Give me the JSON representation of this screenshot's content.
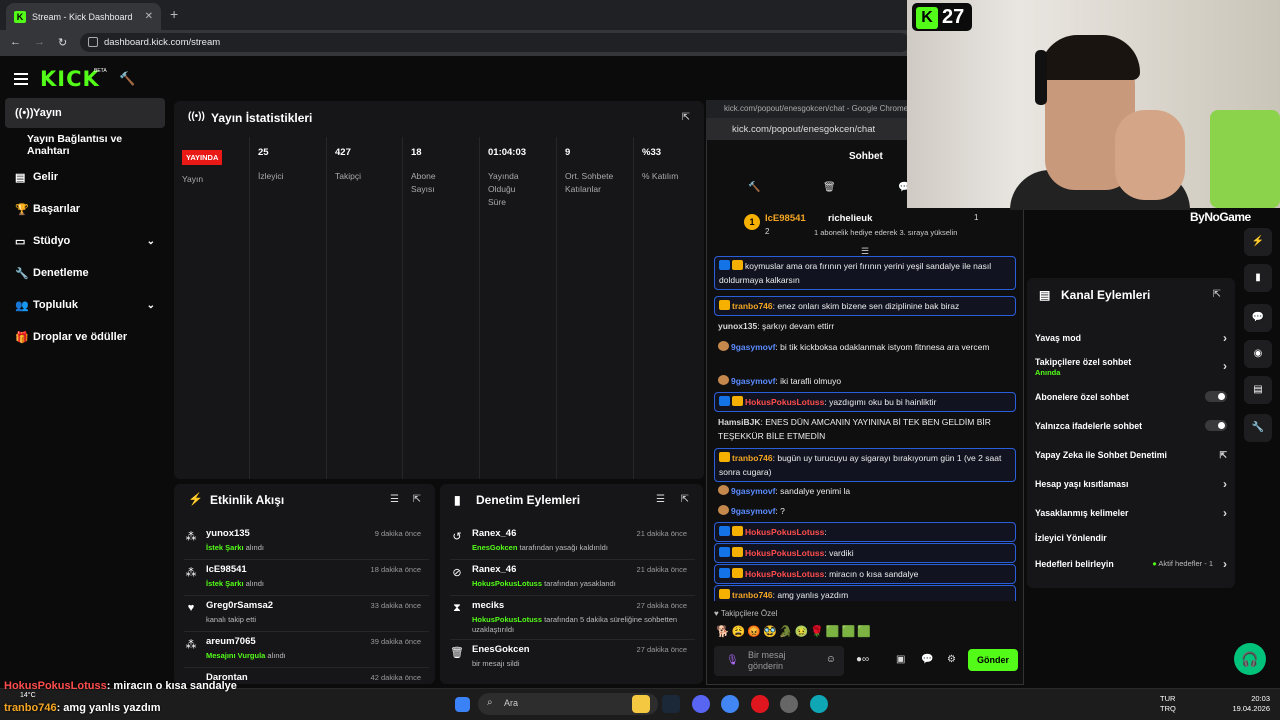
{
  "browser": {
    "tab_title": "Stream - Kick Dashboard",
    "url": "dashboard.kick.com/stream"
  },
  "header": {
    "logo": "KICK",
    "beta": "BETA"
  },
  "sidebar": {
    "items": [
      {
        "label": "Yayın",
        "icon": "broadcast-icon",
        "active": true
      },
      {
        "label": "Yayın Bağlantısı ve Anahtarı",
        "icon": ""
      },
      {
        "label": "Gelir",
        "icon": "revenue-icon"
      },
      {
        "label": "Başarılar",
        "icon": "trophy-icon"
      },
      {
        "label": "Stüdyo",
        "icon": "studio-icon",
        "chevron": true
      },
      {
        "label": "Denetleme",
        "icon": "wrench-icon"
      },
      {
        "label": "Topluluk",
        "icon": "community-icon",
        "chevron": true
      },
      {
        "label": "Droplar ve ödüller",
        "icon": "gift-icon"
      }
    ]
  },
  "stats": {
    "title": "Yayın İstatistikleri",
    "live_badge": "YAYINDA",
    "columns": [
      {
        "value": "",
        "label": "Yayın"
      },
      {
        "value": "25",
        "label": "İzleyici"
      },
      {
        "value": "427",
        "label": "Takipçi"
      },
      {
        "value": "18",
        "label": "Abone Sayısı"
      },
      {
        "value": "01:04:03",
        "label": "Yayında Olduğu Süre"
      },
      {
        "value": "9",
        "label": "Ort. Sohbete Katılanlar"
      },
      {
        "value": "%33",
        "label": "% Katılım"
      }
    ]
  },
  "activity": {
    "title": "Etkinlik Akışı",
    "rows": [
      {
        "user": "yunox135",
        "highlight": "İstek Şarkı",
        "desc": " alındı",
        "time": "9 dakika önce"
      },
      {
        "user": "IcE98541",
        "highlight": "İstek Şarkı",
        "desc": " alındı",
        "time": "18 dakika önce"
      },
      {
        "user": "Greg0rSamsa2",
        "highlight": "",
        "desc": "kanalı takip etti",
        "time": "33 dakika önce"
      },
      {
        "user": "areum7065",
        "highlight": "Mesajını Vurgula",
        "desc": " alındı",
        "time": "39 dakika önce"
      },
      {
        "user": "Darontan",
        "highlight": "",
        "desc": "",
        "time": "42 dakika önce"
      }
    ]
  },
  "modlog": {
    "title": "Denetim Eylemleri",
    "rows": [
      {
        "user": "Ranex_46",
        "highlight": "EnesGokcen",
        "desc": " tarafından yasağı kaldırıldı",
        "time": "21 dakika önce"
      },
      {
        "user": "Ranex_46",
        "highlight": "HokusPokusLotuss",
        "desc": " tarafından yasaklandı",
        "time": "21 dakika önce"
      },
      {
        "user": "meciks",
        "highlight": "HokusPokusLotuss",
        "desc": " tarafından 5 dakika süreliğine sohbetten uzaklaştırıldı",
        "time": "27 dakika önce"
      },
      {
        "user": "EnesGokcen",
        "highlight": "",
        "desc": "bir mesajı sildi",
        "time": "27 dakika önce"
      }
    ]
  },
  "chat": {
    "window_title": "kick.com/popout/enesgokcen/chat - Google Chrome",
    "url": "kick.com/popout/enesgokcen/chat",
    "tab": "Sohbet",
    "leader1_name": "IcE98541",
    "leader1_count": "2",
    "leader1_rank": "1",
    "leader2_name": "richelieuk",
    "leader2_count": "1",
    "leader2_sub": "1 abonelik hediye ederek 3. sıraya yükselin",
    "messages": [
      {
        "name": "",
        "color": "#53fc18",
        "text": "koymuslar ama ora fırının yeri fırının yerini yeşil sandalye ile nasıl doldurmaya kalkarsın",
        "badges": [
          "mod",
          "crown"
        ],
        "hl": true
      },
      {
        "name": "tranbo746",
        "color": "#f5a623",
        "text": ": enez onları skim bizene sen diziplinine bak biraz",
        "badges": [
          "crown"
        ],
        "hl": true
      },
      {
        "name": "yunox135",
        "color": "#d9d9d9",
        "text": ": şarkıyı devam ettirr",
        "badges": [],
        "hl": false
      },
      {
        "name": "9gasymovf",
        "color": "#5b8cff",
        "text": ": bi tik kickboksa odaklanmak istyom fitnnesa ara vercem",
        "badges": [
          "bag"
        ],
        "hl": false
      },
      {
        "name": "9gasymovf",
        "color": "#5b8cff",
        "text": ": iki tarafli olmuyo",
        "badges": [
          "bag"
        ],
        "hl": false
      },
      {
        "name": "HokusPokusLotuss",
        "color": "#ff4d4d",
        "text": ": yazdıgımı oku bu bi hainliktir",
        "badges": [
          "mod",
          "crown"
        ],
        "hl": true
      },
      {
        "name": "HamsiBJK",
        "color": "#d9d9d9",
        "text": ": ENES DÜN AMCANIN YAYININA Bİ TEK BEN GELDİM BİR TEŞEKKÜR BİLE ETMEDİN",
        "badges": [],
        "hl": false
      },
      {
        "name": "tranbo746",
        "color": "#f5a623",
        "text": ": bugün uy turucuyu ay sigarayı bırakıyorum gün 1 (ve 2 saat sonra cugara)",
        "badges": [
          "crown"
        ],
        "hl": true
      },
      {
        "name": "9gasymovf",
        "color": "#5b8cff",
        "text": ": sandalye yenimi la",
        "badges": [
          "bag"
        ],
        "hl": false
      },
      {
        "name": "9gasymovf",
        "color": "#5b8cff",
        "text": ": ?",
        "badges": [
          "bag"
        ],
        "hl": false
      },
      {
        "name": "HokusPokusLotuss",
        "color": "#ff4d4d",
        "text": ":",
        "badges": [
          "mod",
          "crown"
        ],
        "hl": true
      },
      {
        "name": "HokusPokusLotuss",
        "color": "#ff4d4d",
        "text": ": vardiki",
        "badges": [
          "mod",
          "crown"
        ],
        "hl": true
      },
      {
        "name": "HokusPokusLotuss",
        "color": "#ff4d4d",
        "text": ": miracın o kısa sandalye",
        "badges": [
          "mod",
          "crown"
        ],
        "hl": true
      },
      {
        "name": "tranbo746",
        "color": "#f5a623",
        "text": ": amg yanlıs yazdım",
        "badges": [
          "crown"
        ],
        "hl": true
      }
    ],
    "follow_only": "Takipçilere Özel",
    "input_placeholder": "Bir mesaj gönderin",
    "send": "Gönder"
  },
  "webcam": {
    "kick_count": "27",
    "brand": "ByNoGame"
  },
  "channel_actions": {
    "title": "Kanal Eylemleri",
    "rows": [
      {
        "label": "Yavaş mod",
        "control": "chevron"
      },
      {
        "label": "Takipçilere özel sohbet",
        "sub": "Anında",
        "control": "chevron"
      },
      {
        "label": "Abonelere özel sohbet",
        "control": "toggle"
      },
      {
        "label": "Yalnızca ifadelerle sohbet",
        "control": "toggle"
      },
      {
        "label": "Yapay Zeka ile Sohbet Denetimi",
        "control": "external"
      },
      {
        "label": "Hesap yaşı kısıtlaması",
        "control": "chevron"
      },
      {
        "label": "Yasaklanmış kelimeler",
        "control": "chevron"
      },
      {
        "label": "İzleyici Yönlendir",
        "control": ""
      },
      {
        "label": "Hedefleri belirleyin",
        "extra": "Aktif hedefler - 1",
        "control": "chevron"
      }
    ]
  },
  "overlay": {
    "line1_name": "HokusPokusLotuss",
    "line1_text": ": miracın o kısa sandalye",
    "line2_name": "tranbo746",
    "line2_text": ": amg yanlıs yazdım"
  },
  "taskbar": {
    "search": "Ara",
    "lang1": "TUR",
    "lang2": "TRQ",
    "time": "20:03",
    "date": "19.04.2026",
    "weather": "14°C"
  }
}
